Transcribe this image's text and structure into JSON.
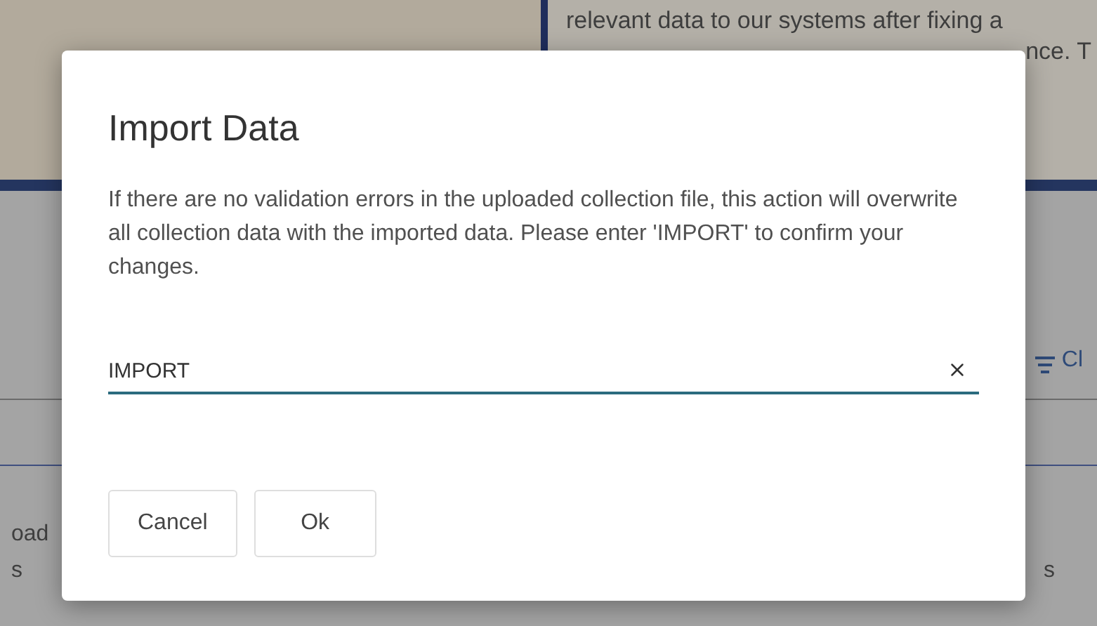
{
  "background": {
    "notice_lines": [
      "relevant data to our systems after fixing a",
      "nce. T"
    ],
    "toolbar_link": "Cl",
    "left_texts": [
      "oad",
      "s"
    ],
    "right_text": "s"
  },
  "dialog": {
    "title": "Import Data",
    "message": "If there are no validation errors in the uploaded collection file, this action will overwrite all collection data with the imported data. Please enter 'IMPORT' to confirm your changes.",
    "input": {
      "value": "IMPORT",
      "focused": true
    },
    "buttons": [
      {
        "label": "Cancel"
      },
      {
        "label": "Ok"
      }
    ]
  }
}
